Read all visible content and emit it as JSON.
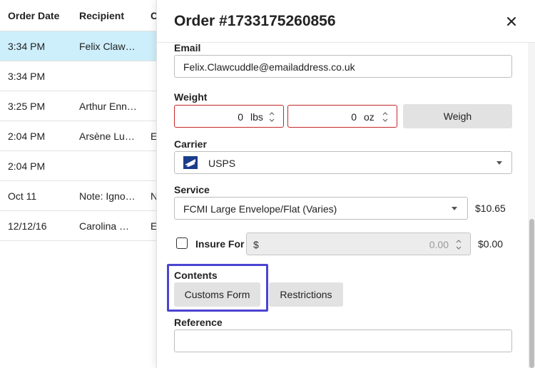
{
  "table": {
    "headers": [
      "Order Date",
      "Recipient",
      "C"
    ],
    "rows": [
      {
        "date": "3:34 PM",
        "recipient": "Felix Claw…",
        "extra": ""
      },
      {
        "date": "3:34 PM",
        "recipient": "",
        "extra": ""
      },
      {
        "date": "3:25 PM",
        "recipient": "Arthur Enn…",
        "extra": ""
      },
      {
        "date": "2:04 PM",
        "recipient": "Arsène Lu…",
        "extra": "E"
      },
      {
        "date": "2:04 PM",
        "recipient": "",
        "extra": ""
      },
      {
        "date": "Oct 11",
        "recipient": "Note: Igno…",
        "extra": "N"
      },
      {
        "date": "12/12/16",
        "recipient": "Carolina …",
        "extra": "E"
      }
    ]
  },
  "drawer": {
    "title": "Order #1733175260856",
    "close_icon": "close-icon",
    "email": {
      "label": "Email",
      "value": "Felix.Clawcuddle@emailaddress.co.uk"
    },
    "weight": {
      "label": "Weight",
      "lbs_value": "0",
      "lbs_unit": "lbs",
      "oz_value": "0",
      "oz_unit": "oz",
      "weigh_label": "Weigh"
    },
    "carrier": {
      "label": "Carrier",
      "value": "USPS",
      "icon": "usps-eagle-icon"
    },
    "service": {
      "label": "Service",
      "value": "FCMI Large Envelope/Flat (Varies)",
      "price": "$10.65"
    },
    "insure": {
      "label": "Insure For",
      "currency": "$",
      "amount": "0.00",
      "price": "$0.00",
      "checked": false
    },
    "contents": {
      "label": "Contents",
      "customs_label": "Customs Form",
      "restrictions_label": "Restrictions"
    },
    "reference": {
      "label": "Reference",
      "value": ""
    }
  },
  "colors": {
    "selected_row": "#cdeefb",
    "error_border": "#c62828",
    "highlight_box": "#4b44d1",
    "button_bg": "#e2e2e2"
  }
}
